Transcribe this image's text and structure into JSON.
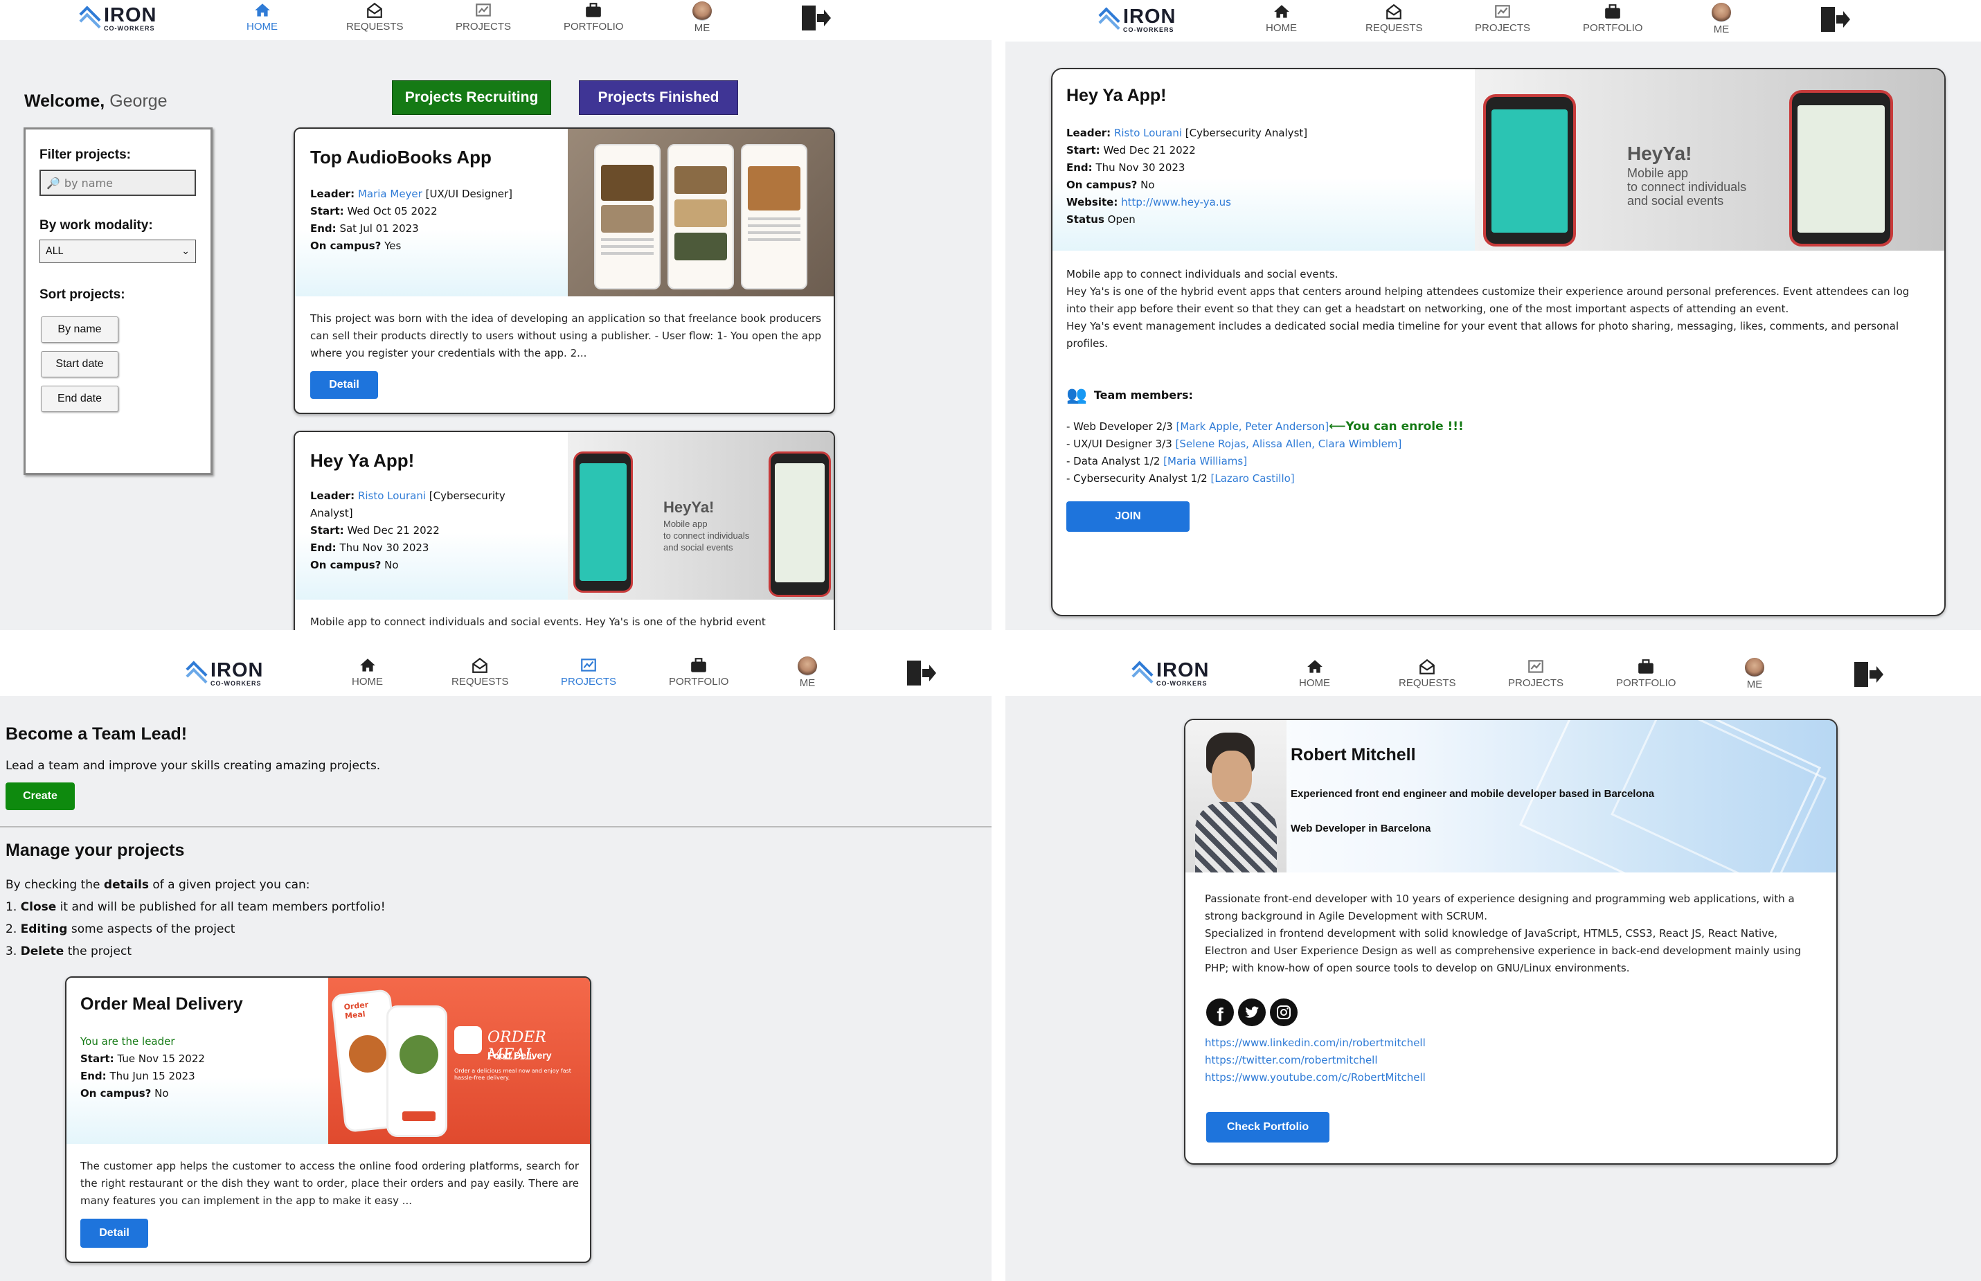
{
  "brand": {
    "big": "IRON",
    "small": "CO-WORKERS"
  },
  "nav": {
    "home": "HOME",
    "requests": "REQUESTS",
    "projects": "PROJECTS",
    "portfolio": "PORTFOLIO",
    "me": "ME"
  },
  "colors": {
    "accent": "#1e74dc",
    "nav_active": "#2f7bd6",
    "recruiting_btn": "#157a15",
    "finished_btn": "#3f3595",
    "enrole": "#157a15",
    "create_btn": "#0e8a0e"
  },
  "home": {
    "welcome_prefix": "Welcome,",
    "welcome_name": "George",
    "btn_recruiting": "Projects Recruiting",
    "btn_finished": "Projects Finished",
    "filter": {
      "title": "Filter projects:",
      "search_placeholder": "by name",
      "modality_label": "By work modality:",
      "modality_value": "ALL",
      "sort_label": "Sort projects:",
      "sort_name": "By name",
      "sort_start": "Start date",
      "sort_end": "End date"
    },
    "projects": [
      {
        "title": "Top AudioBooks App",
        "leader_label": "Leader:",
        "leader": "Maria Meyer",
        "role": "[UX/UI Designer]",
        "start_label": "Start:",
        "start": "Wed Oct 05 2022",
        "end_label": "End:",
        "end": "Sat Jul 01 2023",
        "campus_label": "On campus?",
        "campus": "Yes",
        "description": "This project was born with the idea of developing an application so that freelance book producers can sell their products directly to users without using a publisher. - User flow: 1- You open the app where you register your credentials with the app. 2...",
        "detail": "Detail"
      },
      {
        "title": "Hey Ya App!",
        "leader_label": "Leader:",
        "leader": "Risto Lourani",
        "role": "[Cybersecurity Analyst]",
        "start_label": "Start:",
        "start": "Wed Dec 21 2022",
        "end_label": "End:",
        "end": "Thu Nov 30 2023",
        "campus_label": "On campus?",
        "campus": "No",
        "description": "Mobile app to connect individuals and social events. Hey Ya's is one of the hybrid event"
      }
    ]
  },
  "detail": {
    "title": "Hey Ya App!",
    "leader_label": "Leader:",
    "leader": "Risto Lourani",
    "role": "[Cybersecurity Analyst]",
    "start_label": "Start:",
    "start": "Wed Dec 21 2022",
    "end_label": "End:",
    "end": "Thu Nov 30 2023",
    "campus_label": "On campus?",
    "campus": "No",
    "website_label": "Website:",
    "website": "http://www.hey-ya.us",
    "status_label": "Status",
    "status": "Open",
    "image": {
      "brand": "HeyYa!",
      "line1": "Mobile app",
      "line2": "to connect individuals",
      "line3": "and social events"
    },
    "desc1": "Mobile app to connect individuals and social events.",
    "desc2": "Hey Ya's is one of the hybrid event apps that centers around helping attendees customize their experience around personal preferences. Event attendees can log into their app before their event so that they can get a headstart on networking, one of the most important aspects of attending an event.",
    "desc3": "Hey Ya's event management includes a dedicated social media timeline for your event that allows for photo sharing, messaging, likes, comments, and personal profiles.",
    "team_label": "Team members:",
    "team": [
      {
        "role": "- Web Developer 2/3",
        "members": "[Mark Apple, Peter Anderson]",
        "note": "⟵You can enrole !!!"
      },
      {
        "role": "- UX/UI Designer 3/3",
        "members": "[Selene Rojas, Alissa Allen, Clara Wimblem]",
        "note": ""
      },
      {
        "role": "- Data Analyst 1/2",
        "members": "[Maria Williams]",
        "note": ""
      },
      {
        "role": "- Cybersecurity Analyst 1/2",
        "members": "[Lazaro Castillo]",
        "note": ""
      }
    ],
    "join": "JOIN"
  },
  "manage": {
    "lead_title": "Become a Team Lead!",
    "lead_text": "Lead a team and improve your skills creating amazing projects.",
    "create": "Create",
    "manage_title": "Manage your projects",
    "intro_pre": "By checking the ",
    "intro_bold": "details",
    "intro_post": " of a given project you can:",
    "steps": [
      {
        "num": "1.",
        "bold": "Close",
        "rest": " it and will be published for all team members portfolio!"
      },
      {
        "num": "2.",
        "bold": "Editing",
        "rest": " some aspects of the project"
      },
      {
        "num": "3.",
        "bold": "Delete",
        "rest": " the project"
      }
    ],
    "project": {
      "title": "Order Meal Delivery",
      "leader_note": "You are the leader",
      "start_label": "Start:",
      "start": "Tue Nov 15 2022",
      "end_label": "End:",
      "end": "Thu Jun 15 2023",
      "campus_label": "On campus?",
      "campus": "No",
      "image_title": "ORDER MEAL",
      "image_sub": "Food Delivery",
      "image_small": "Order a delicious meal now and enjoy fast hassle-free delivery.",
      "image_logo": "Order Meal",
      "description": "The customer app helps the customer to access the online food ordering platforms, search for the right restaurant or the dish they want to order, place their orders and pay easily. There are many features you can implement in the app to make it easy ...",
      "detail": "Detail"
    }
  },
  "profile": {
    "name": "Robert Mitchell",
    "headline": "Experienced front end engineer and mobile developer based in Barcelona",
    "role": "Web Developer in Barcelona",
    "bio1": "Passionate front-end developer with 10 years of experience designing and programming web applications, with a strong background in Agile Development with SCRUM.",
    "bio2": "Specialized in frontend development with solid knowledge of JavaScript, HTML5, CSS3, React JS, React Native, Electron and User Experience Design as well as comprehensive experience in back-end development mainly using PHP; with know-how of open source tools to develop on GNU/Linux environments.",
    "links": [
      "https://www.linkedin.com/in/robertmitchell",
      "https://twitter.com/robertmitchell",
      "https://www.youtube.com/c/RobertMitchell"
    ],
    "check": "Check Portfolio"
  }
}
